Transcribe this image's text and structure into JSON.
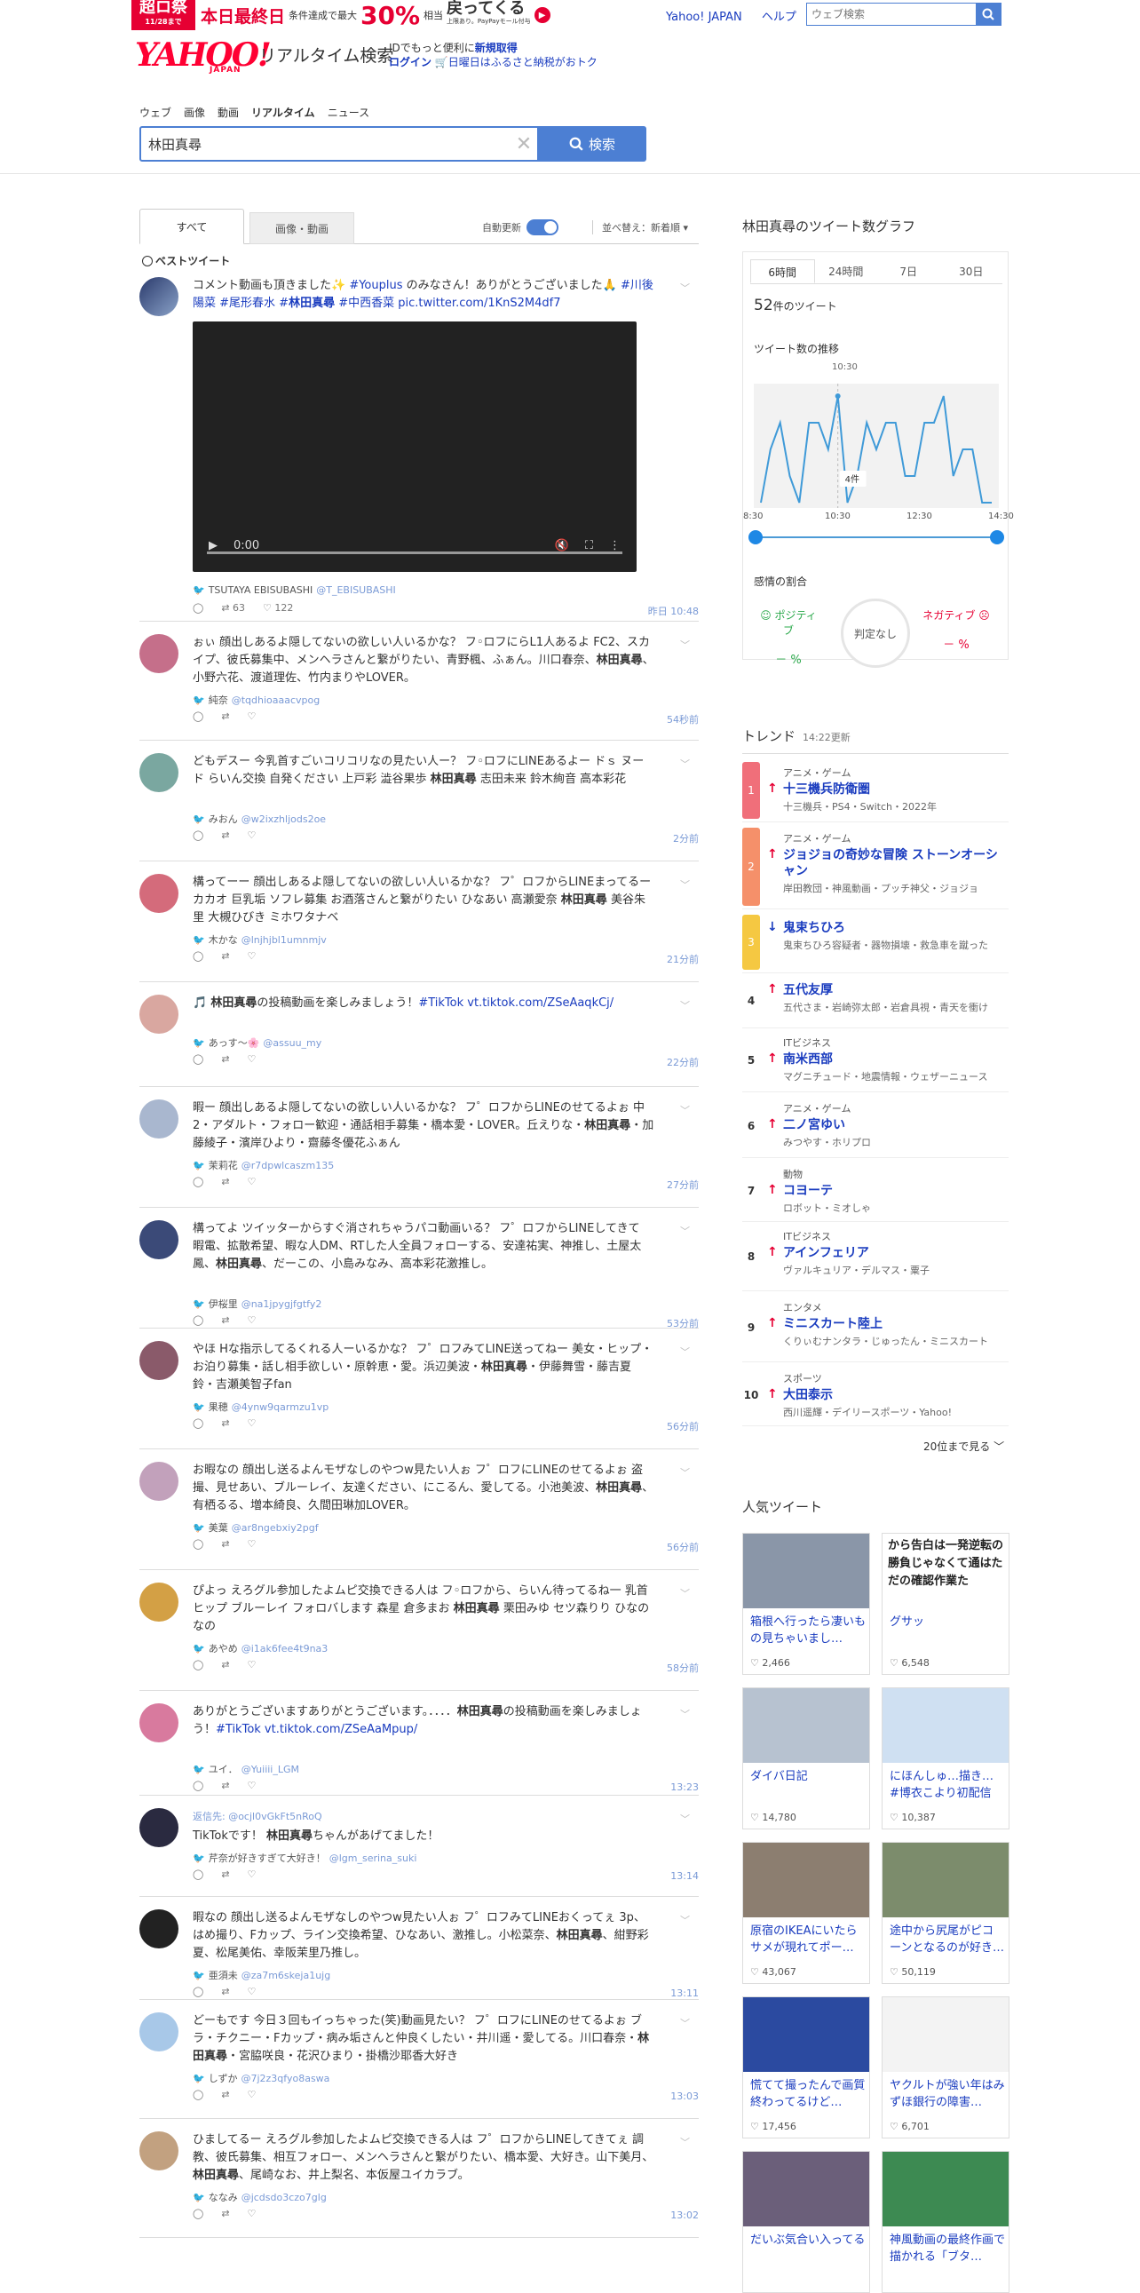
{
  "promo": {
    "badge": "超ロ祭",
    "badge_sub": "11/28まで",
    "headline": "本日最終日",
    "cond": "条件達成で最大",
    "pct": "30%",
    "pct_sub": "相当",
    "back": "戻ってくる",
    "back_sub": "上限あり。PayPayモール付与"
  },
  "toplinks": [
    "Yahoo! JAPAN",
    "ヘルプ"
  ],
  "web_search_placeholder": "ウェブ検索",
  "logo": {
    "main": "YAHOO!",
    "sub": "JAPAN",
    "service": "リアルタイム検索"
  },
  "idarea": {
    "line1_prefix": "IDでもっと便利に",
    "line1_link": "新規取得",
    "login": "ログイン",
    "furusato": "日曜日はふるさと納税がおトク"
  },
  "nav": [
    "ウェブ",
    "画像",
    "動画",
    "リアルタイム",
    "ニュース"
  ],
  "search": {
    "query": "林田真尋",
    "button": "検索"
  },
  "tabs": {
    "all": "すべて",
    "media": "画像・動画",
    "auto": "自動更新",
    "sort": "並べ替え：新着順"
  },
  "best_label": "ベストツイート",
  "tweets": [
    {
      "text_a": "コメント動画も頂きました✨ ",
      "h1": "#Youplus",
      "text_b": " のみなさん！ありがとうございました🙏 ",
      "h2": "#川後陽菜 #尾形春水 #",
      "kw": "林田真尋",
      "h3": " #中西香菜",
      "link": " pic.twitter.com/1KnS2M4df7",
      "author": "TSUTAYA EBISUBASHI",
      "handle": "@T_EBISUBASHI",
      "rt": "63",
      "like": "122",
      "time": "昨日 10:48",
      "video_time": "0:00"
    },
    {
      "text": "ぉぃ 顔出しあるよ隠してないの欲しい人いるかな？ フ◦ロフにらL1人あるよ FC2、スカイプ、彼氏募集中、メンヘラさんと繋がりたい、青野楓、ふぁん。川口春奈、",
      "kw": "林田真尋",
      "text2": "、小野六花、渡道理佐、竹内まりやLOVER。",
      "author": "純奈",
      "handle": "@tqdhioaaacvpog",
      "time": "54秒前"
    },
    {
      "text": "どもデスー 今乳首すごいコリコリなの見たい人ー？ フ◦ロフにLINEあるよー ドｓ ヌード らいん交換 自発ください 上戸彩 澁谷果歩 ",
      "kw": "林田真尋",
      "text2": " 志田未来 鈴木絢音 高本彩花",
      "author": "みおん",
      "handle": "@w2ixzhljods2oe",
      "time": "2分前"
    },
    {
      "text": "構ってーー 顔出しあるよ隠してないの欲しい人いるかな？ フ゜ロフからLINEまってるー カカオ 巨乳垢 ソフレ募集 お酒落さんと繋がりたい ひなあい 高瀬愛奈 ",
      "kw": "林田真尋",
      "text2": " 美谷朱里 大槻ひびき ミホワタナベ",
      "author": "木かな",
      "handle": "@lnjhjbl1umnmjv",
      "time": "21分前"
    },
    {
      "text": "🎵 ",
      "kw": "林田真尋",
      "text2": "の投稿動画を楽しみましょう！",
      "link": "#TikTok vt.tiktok.com/ZSeAaqkCj/",
      "author": "あっす〜🌸",
      "handle": "@assuu_my",
      "time": "22分前"
    },
    {
      "text": "暇ー 顔出しあるよ隠してないの欲しい人いるかな？ フ゜ロフからLINEのせてるよぉ 中2・アダルト・フォロー歓迎・通話相手募集・橋本愛・LOVER。丘えりな・",
      "kw": "林田真尋",
      "text2": "・加藤綾子・濱岸ひより・齋藤冬優花ふぁん",
      "author": "茉莉花",
      "handle": "@r7dpwlcaszm135",
      "time": "27分前"
    },
    {
      "text": "構ってよ ツイッターからすぐ消されちゃうパコ動画いる？ フ゜ロフからLINEしてきて 暇電、拡散希望、暇な人DM、RTした人全員フォローする、安達祐実、神推し、土屋太鳳、",
      "kw": "林田真尋",
      "text2": "、だーこの、小島みなみ、高本彩花激推し。",
      "author": "伊桜里",
      "handle": "@na1jpygjfgtfy2",
      "time": "53分前"
    },
    {
      "text": "やほ Hな指示してるくれる人ーいるかな？ フ゜ロフみてLINE送ってねー 美女・ヒップ・お泊り募集・話し相手欲しい・原幹恵・愛。浜辺美波・",
      "kw": "林田真尋",
      "text2": "・伊藤舞雪・藤吉夏鈴・吉瀬美智子fan",
      "author": "果穂",
      "handle": "@4ynw9qarmzu1vp",
      "time": "56分前"
    },
    {
      "text": "お暇なの 顔出し送るよんモザなしのやつw見たい人ぉ フ゜ロフにLINEのせてるよぉ 盗撮、見せあい、ブルーレイ、友達ください、にこるん、愛してる。小池美波、",
      "kw": "林田真尋",
      "text2": "、有栖るる、増本綺良、久間田琳加LOVER。",
      "author": "美葉",
      "handle": "@ar8ngebxiy2pgf",
      "time": "56分前"
    },
    {
      "text": "ぴよっ えろグル参加したよムピ交換できる人は フ◦ロフから、らいん待ってるね一 乳首 ヒップ ブルーレイ フォロバします 森星 倉多まお ",
      "kw": "林田真尋",
      "text2": " 栗田みゆ セツ森りり ひなのなの",
      "author": "あやめ",
      "handle": "@i1ak6fee4t9na3",
      "time": "58分前"
    },
    {
      "text": "ありがとうございますありがとうございます。．．．．",
      "kw": "林田真尋",
      "text2": "の投稿動画を楽しみましょう！",
      "link": "#TikTok vt.tiktok.com/ZSeAaMpup/",
      "author": "ユイ．",
      "handle": "@Yuiiii_LGM",
      "time": "13:23"
    },
    {
      "reply_to": "返信先: @ocjl0vGkFt5nRoQ",
      "text": "TikTokです！ ",
      "kw": "林田真尋",
      "text2": "ちゃんがあげてました！",
      "author": "芹奈が好きすぎて大好き！",
      "handle": "@lgm_serina_suki",
      "time": "13:14"
    },
    {
      "text": "暇なの 顔出し送るよんモザなしのやつw見たい人ぉ フ゜ロフみてLINEおくってぇ 3p、はめ撮り、Fカップ、ライン交換希望、ひなあい、激推し。小松菜奈、",
      "kw": "林田真尋",
      "text2": "、紺野彩夏、松尾美佑、幸阪茉里乃推し。",
      "author": "亜須未",
      "handle": "@za7m6skeja1ujg",
      "time": "13:11"
    },
    {
      "text": "どーもです 今日３回もイっちゃった(笑)動画見たい？ フ゜ロフにLINEのせてるよぉ ブラ・チクニー・Fカップ・病み垢さんと仲良くしたい・井川遥・愛してる。川口春奈・",
      "kw": "林田真尋",
      "text2": "・宮脇咲良・花沢ひまり・掛橋沙耶香大好き",
      "author": "しずか",
      "handle": "@7j2z3qfyo8aswa",
      "time": "13:03"
    },
    {
      "text": "ひましてるー えろグル参加したよムピ交換できる人は フ゜ロフからLINEしてきてぇ 調教、彼氏募集、相互フォロー、メンヘラさんと繋がりたい、橋本愛、大好き。山下美月、",
      "kw": "林田真尋",
      "text2": "、尾崎なお、井上梨名、本仮屋ユイカラブ。",
      "author": "ななみ",
      "handle": "@jcdsdo3czo7glg",
      "time": "13:02"
    }
  ],
  "graph": {
    "title": "林田真尋のツイート数グラフ",
    "tabs": [
      "6時間",
      "24時間",
      "7日",
      "30日"
    ],
    "count": "52",
    "count_suffix": "件のツイート",
    "subtitle": "ツイート数の推移",
    "hover_time": "10:30",
    "hover_value": "4件",
    "emotion_title": "感情の割合",
    "positive": "ポジティブ",
    "negative": "ネガティブ",
    "pos_val": "－ %",
    "neg_val": "－ %",
    "judge": "判定なし"
  },
  "chart_data": {
    "type": "line",
    "x": [
      "8:30",
      "8:45",
      "9:00",
      "9:15",
      "9:30",
      "9:45",
      "10:00",
      "10:15",
      "10:30",
      "10:45",
      "11:00",
      "11:15",
      "11:30",
      "11:45",
      "12:00",
      "12:15",
      "12:30",
      "12:45",
      "13:00",
      "13:15",
      "13:30",
      "13:45",
      "14:00",
      "14:15",
      "14:30"
    ],
    "values": [
      0,
      2,
      3,
      1,
      0,
      3,
      3,
      2,
      4,
      0,
      1,
      3,
      2,
      3,
      3,
      1,
      1,
      3,
      3,
      4,
      1,
      2,
      2,
      0,
      0
    ],
    "xlabel": "",
    "ylabel": "",
    "xticks": [
      "8:30",
      "10:30",
      "12:30",
      "14:30"
    ],
    "grid": false
  },
  "trend": {
    "title": "トレンド",
    "updated": "14:22更新",
    "items": [
      {
        "rank": "1",
        "cat": "アニメ・ゲーム",
        "title": "十三機兵防衛圏",
        "desc": "十三機兵・PS4・Switch・2022年",
        "dir": "up",
        "color": "#f06f7a"
      },
      {
        "rank": "2",
        "cat": "アニメ・ゲーム",
        "title": "ジョジョの奇妙な冒険 ストーンオーシャン",
        "desc": "岸田教団・神風動画・プッチ神父・ジョジョ",
        "dir": "up",
        "color": "#f5906a"
      },
      {
        "rank": "3",
        "cat": "",
        "title": "鬼束ちひろ",
        "desc": "鬼束ちひろ容疑者・器物損壊・救急車を蹴った",
        "dir": "down",
        "color": "#f5c842"
      },
      {
        "rank": "4",
        "cat": "",
        "title": "五代友厚",
        "desc": "五代さま・岩崎弥太郎・岩倉具視・青天を衝け",
        "dir": "up",
        "color": ""
      },
      {
        "rank": "5",
        "cat": "ITビジネス",
        "title": "南米西部",
        "desc": "マグニチュード・地震情報・ウェザーニュース",
        "dir": "up",
        "color": ""
      },
      {
        "rank": "6",
        "cat": "アニメ・ゲーム",
        "title": "二ノ宮ゆい",
        "desc": "みつやす・ホリプロ",
        "dir": "up",
        "color": ""
      },
      {
        "rank": "7",
        "cat": "動物",
        "title": "コヨーテ",
        "desc": "ロボット・ミオしゃ",
        "dir": "up",
        "color": ""
      },
      {
        "rank": "8",
        "cat": "ITビジネス",
        "title": "アインフェリア",
        "desc": "ヴァルキュリア・デルマス・粟子",
        "dir": "up",
        "color": ""
      },
      {
        "rank": "9",
        "cat": "エンタメ",
        "title": "ミニスカート陸上",
        "desc": "くりぃむナンタラ・じゅったん・ミニスカート",
        "dir": "up",
        "color": ""
      },
      {
        "rank": "10",
        "cat": "スポーツ",
        "title": "大田泰示",
        "desc": "西川遥輝・デイリースポーツ・Yahoo!",
        "dir": "up",
        "color": ""
      }
    ],
    "more": "20位まで見る"
  },
  "popular": {
    "title": "人気ツイート",
    "cards": [
      {
        "text": "箱根へ行ったら凄いもの見ちゃいまし…",
        "likes": "2,466",
        "bg": "#8a96a8"
      },
      {
        "text": "グサッ",
        "likes": "6,548",
        "bg": "#ffffff",
        "top": "から告白は一発逆転の勝負じゃなくて通はただの確認作業た"
      },
      {
        "text": "ダイバ日記",
        "likes": "14,780",
        "bg": "#b7c2d0"
      },
      {
        "text": "にほんしゅ…描き… #博衣こより初配信",
        "likes": "10,387",
        "bg": "#cfe0f2"
      },
      {
        "text": "原宿のIKEAにいたらサメが現れてポー…",
        "likes": "43,067",
        "bg": "#8c7e70"
      },
      {
        "text": "途中から尻尾がピコーンとなるのが好き…",
        "likes": "50,119",
        "bg": "#7c8c6c"
      },
      {
        "text": "慌てて撮ったんで画質終わってるけど…",
        "likes": "17,456",
        "bg": "#2b4aa0"
      },
      {
        "text": "ヤクルトが強い年はみずほ銀行の障害…",
        "likes": "6,701",
        "bg": "#f3f3f3"
      },
      {
        "text": "だいぶ気合い入ってる",
        "likes": "",
        "bg": "#6b5f7a"
      },
      {
        "text": "神風動画の最終作画で描かれる「ブタ…",
        "likes": "",
        "bg": "#3d8a52"
      }
    ]
  }
}
